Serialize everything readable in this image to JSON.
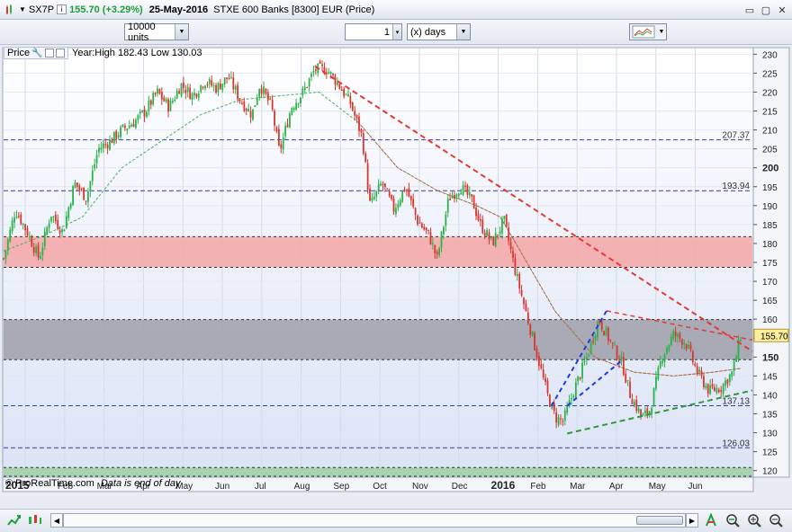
{
  "header": {
    "symbol": "SX7P",
    "change": "155.70 (+3.29%)",
    "date": "25-May-2016",
    "instrument": "STXE 600 Banks [8300] EUR (Price)"
  },
  "toolbar": {
    "units_value": "10000 units",
    "period_value": "1",
    "timeframe_value": "(x) days"
  },
  "panel": {
    "price_label": "Price",
    "year_info": "Year:High 182.43 Low 130.03"
  },
  "footer": {
    "brand": "© ProRealTime.com",
    "note": "Data is end of day"
  },
  "chart_data": {
    "type": "candlestick",
    "series_name": "SX7P",
    "x_tick_labels": [
      "2015",
      "Feb",
      "Mar",
      "Apr",
      "May",
      "Jun",
      "Jul",
      "Aug",
      "Sep",
      "Oct",
      "Nov",
      "Dec",
      "2016",
      "Feb",
      "Mar",
      "Apr",
      "May",
      "Jun"
    ],
    "y_ticks": [
      120,
      125,
      130,
      135,
      140,
      145,
      150,
      155,
      160,
      165,
      170,
      175,
      180,
      185,
      190,
      195,
      200,
      205,
      210,
      215,
      220,
      225,
      230
    ],
    "y_bold_ticks": [
      150,
      200
    ],
    "ylim": [
      118.5,
      231.5
    ],
    "last_price": "155.70",
    "horizontal_levels": [
      {
        "value": 207.37,
        "label": "207.37"
      },
      {
        "value": 193.94,
        "label": "193.94"
      },
      {
        "value": 137.13,
        "label": "137.13"
      },
      {
        "value": 126.03,
        "label": "126.03"
      }
    ],
    "zones": [
      {
        "from": 173.7,
        "to": 181.8,
        "color": "#f4a6a6"
      },
      {
        "from": 149.3,
        "to": 159.9,
        "color": "#9d9faa"
      },
      {
        "from": 118.5,
        "to": 120.8,
        "color": "#9fcfa2"
      }
    ],
    "price_path": [
      [
        0,
        176
      ],
      [
        0.3,
        189
      ],
      [
        0.6,
        183
      ],
      [
        0.9,
        176
      ],
      [
        1.2,
        188
      ],
      [
        1.5,
        183
      ],
      [
        1.8,
        196
      ],
      [
        2.1,
        192
      ],
      [
        2.4,
        205
      ],
      [
        2.7,
        207
      ],
      [
        3.0,
        210
      ],
      [
        3.3,
        212
      ],
      [
        3.6,
        215
      ],
      [
        3.9,
        220
      ],
      [
        4.2,
        216
      ],
      [
        4.5,
        222
      ],
      [
        4.8,
        219
      ],
      [
        5.1,
        223
      ],
      [
        5.4,
        221
      ],
      [
        5.7,
        224
      ],
      [
        6.0,
        218
      ],
      [
        6.3,
        214
      ],
      [
        6.5,
        222
      ],
      [
        6.8,
        216
      ],
      [
        7.0,
        204
      ],
      [
        7.3,
        216
      ],
      [
        7.6,
        220
      ],
      [
        7.9,
        226
      ],
      [
        8.2,
        226
      ],
      [
        8.5,
        222
      ],
      [
        8.8,
        217
      ],
      [
        9.1,
        208
      ],
      [
        9.3,
        190
      ],
      [
        9.6,
        196
      ],
      [
        9.9,
        189
      ],
      [
        10.2,
        195
      ],
      [
        10.5,
        186
      ],
      [
        10.8,
        182
      ],
      [
        11.0,
        176
      ],
      [
        11.3,
        192
      ],
      [
        11.6,
        195
      ],
      [
        11.9,
        191
      ],
      [
        12.1,
        185
      ],
      [
        12.4,
        180
      ],
      [
        12.7,
        186
      ],
      [
        13.0,
        172
      ],
      [
        13.3,
        160
      ],
      [
        13.6,
        148
      ],
      [
        13.8,
        140
      ],
      [
        14.0,
        134
      ],
      [
        14.2,
        133
      ],
      [
        14.5,
        142
      ],
      [
        14.8,
        150
      ],
      [
        15.1,
        160
      ],
      [
        15.4,
        154
      ],
      [
        15.7,
        148
      ],
      [
        15.9,
        140
      ],
      [
        16.2,
        134
      ],
      [
        16.4,
        136
      ],
      [
        16.7,
        150
      ],
      [
        17.0,
        156
      ],
      [
        17.3,
        154
      ],
      [
        17.6,
        146
      ],
      [
        17.9,
        141
      ],
      [
        18.2,
        142
      ],
      [
        18.5,
        146
      ],
      [
        18.7,
        155.7
      ]
    ],
    "moving_average": [
      [
        0,
        178
      ],
      [
        1,
        182
      ],
      [
        2,
        187
      ],
      [
        3,
        200
      ],
      [
        4,
        207
      ],
      [
        5,
        214
      ],
      [
        6,
        218
      ],
      [
        7,
        219
      ],
      [
        8,
        220
      ],
      [
        9,
        212
      ],
      [
        10,
        200
      ],
      [
        11,
        194
      ],
      [
        12,
        190
      ],
      [
        12.6,
        187
      ],
      [
        13,
        180
      ],
      [
        14,
        162
      ],
      [
        15,
        150
      ],
      [
        16,
        146
      ],
      [
        17,
        145
      ],
      [
        18,
        146
      ],
      [
        18.7,
        147
      ]
    ],
    "trendlines": [
      {
        "from": [
          7.9,
          226.8
        ],
        "to": [
          19.0,
          151.5
        ],
        "color": "#e53935",
        "dash": "6,4",
        "width": 2
      },
      {
        "from": [
          15.3,
          162.2
        ],
        "to": [
          19.0,
          154.5
        ],
        "color": "#e53935",
        "dash": "5,4",
        "width": 1.5
      },
      {
        "from": [
          14.3,
          129.8
        ],
        "to": [
          19.0,
          141.2
        ],
        "color": "#2e9a3a",
        "dash": "6,4",
        "width": 2
      },
      {
        "from": [
          13.9,
          137.1
        ],
        "to": [
          15.3,
          162.2
        ],
        "color": "#1e3de0",
        "dash": "5,4",
        "width": 2
      },
      {
        "from": [
          14.3,
          137.1
        ],
        "to": [
          15.7,
          149.2
        ],
        "color": "#1e3de0",
        "dash": "5,4",
        "width": 2
      }
    ],
    "grid": "vertical and horizontal",
    "legend": "none"
  },
  "icons": {
    "window": [
      "restore-icon",
      "maximize-icon",
      "close-icon"
    ],
    "scrollbar": [
      "drawing-tools-icon",
      "candle-style-icon",
      "arrow-left-icon",
      "arrow-right-icon",
      "zoom-in-icon",
      "zoom-out-icon",
      "auto-fit-icon"
    ]
  },
  "colors": {
    "up_candle": "#2bb34a",
    "down_candle": "#d7372f",
    "chart_bg_top": "#ffffff",
    "chart_bg_bottom": "#dfe6f7",
    "axis_label_box": "#ffee9e",
    "accent_green": "#1e9e3a"
  }
}
